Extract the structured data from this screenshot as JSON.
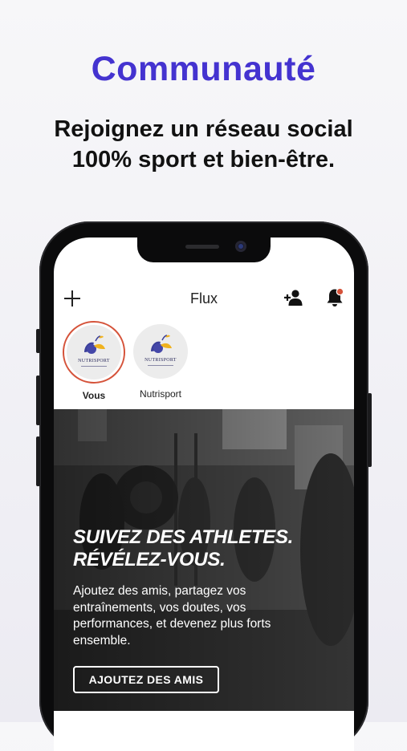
{
  "promo": {
    "headline": "Communauté",
    "subline_1": "Rejoignez un réseau social",
    "subline_2": "100% sport et bien-être."
  },
  "app": {
    "title": "Flux",
    "stories": [
      {
        "label": "Vous",
        "logo_text": "NUTRISPORT",
        "active": true
      },
      {
        "label": "Nutrisport",
        "logo_text": "NUTRISPORT",
        "active": false
      }
    ],
    "banner": {
      "title_1": "SUIVEZ DES ATHLETES.",
      "title_2": "RÉVÉLEZ-VOUS.",
      "text": "Ajoutez des amis, partagez vos entraînements, vos doutes, vos performances, et devenez plus forts ensemble.",
      "button": "AJOUTEZ DES AMIS"
    }
  },
  "colors": {
    "headline": "#4433d0",
    "story_ring": "#d5533a",
    "notification_dot": "#d5533a"
  },
  "icons": [
    "plus-icon",
    "add-user-icon",
    "bell-icon",
    "nutrisport-logo"
  ]
}
